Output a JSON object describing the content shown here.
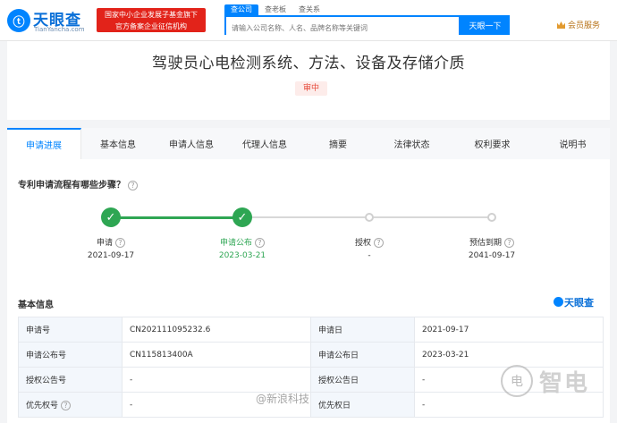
{
  "header": {
    "logo_mark": "ⓣ",
    "logo_name": "天眼查",
    "logo_sub": "TianYancha.com",
    "promo_line1": "国家中小企业发展子基金旗下",
    "promo_line2": "官方备案企业征信机构",
    "search_tabs": [
      "查公司",
      "查老板",
      "查关系"
    ],
    "search_placeholder": "请输入公司名称、人名、品牌名称等关键词",
    "search_button": "天眼一下",
    "vip_label": "会员服务"
  },
  "patent": {
    "title": "驾驶员心电检测系统、方法、设备及存储介质",
    "status": "审中"
  },
  "tabs": [
    "申请进展",
    "基本信息",
    "申请人信息",
    "代理人信息",
    "摘要",
    "法律状态",
    "权利要求",
    "说明书"
  ],
  "progress": {
    "question": "专利申请流程有哪些步骤？",
    "help": "?",
    "steps": [
      {
        "label": "申请",
        "date": "2021-09-17",
        "done": true
      },
      {
        "label": "申请公布",
        "date": "2023-03-21",
        "done": true
      },
      {
        "label": "授权",
        "date": "-",
        "done": false
      },
      {
        "label": "预估到期",
        "date": "2041-09-17",
        "done": false
      }
    ]
  },
  "basic_info": {
    "heading": "基本信息",
    "brand": "天眼查",
    "rows": [
      [
        "申请号",
        "CN202111095232.6",
        "申请日",
        "2021-09-17"
      ],
      [
        "申请公布号",
        "CN115813400A",
        "申请公布日",
        "2023-03-21"
      ],
      [
        "授权公告号",
        "-",
        "授权公告日",
        "-"
      ],
      [
        "优先权号",
        "-",
        "优先权日",
        "-"
      ]
    ]
  },
  "watermark": {
    "weibo": "@新浪科技",
    "brand_mark": "电",
    "brand_text": "智电"
  }
}
